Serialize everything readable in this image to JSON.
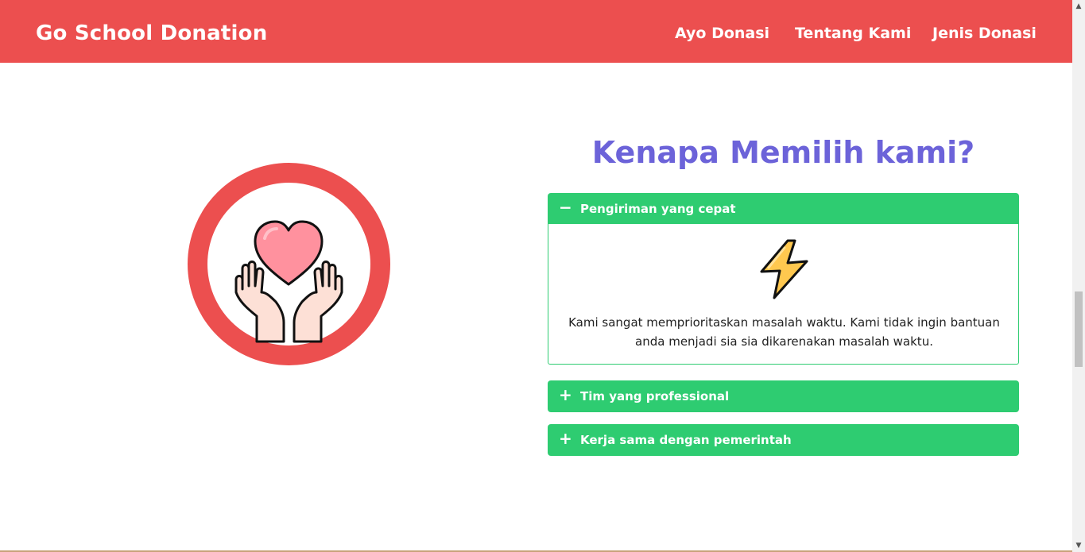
{
  "navbar": {
    "brand": "Go School Donation",
    "links": [
      "Ayo Donasi",
      "Tentang Kami",
      "Jenis Donasi"
    ],
    "color": "#ec4f4f"
  },
  "section": {
    "title": "Kenapa Memilih kami?",
    "title_color": "#6c63d9",
    "logo_icon": "hands-heart-icon"
  },
  "accordion": {
    "color": "#2ecc71",
    "items": [
      {
        "sign": "−",
        "title": "Pengiriman yang cepat",
        "expanded": true,
        "icon": "lightning-bolt-icon",
        "text": "Kami sangat memprioritaskan masalah waktu. Kami tidak ingin bantuan anda menjadi sia sia dikarenakan masalah waktu."
      },
      {
        "sign": "+",
        "title": "Tim yang professional",
        "expanded": false
      },
      {
        "sign": "+",
        "title": "Kerja sama dengan pemerintah",
        "expanded": false
      }
    ]
  },
  "scrollbar": {
    "up_glyph": "▲",
    "down_glyph": "▼"
  }
}
